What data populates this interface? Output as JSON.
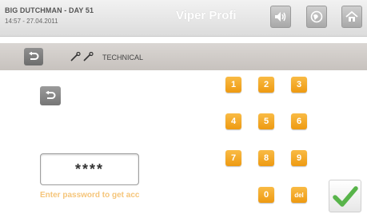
{
  "header": {
    "site": "BIG DUTCHMAN - DAY 51",
    "datetime": "14:57 - 27.04.2011",
    "app_name": "Viper Profi",
    "icons": [
      "speaker-icon",
      "globe-icon",
      "home-icon"
    ]
  },
  "subheader": {
    "breadcrumb": "TECHNICAL",
    "icons": [
      "back-icon",
      "wrench-icon"
    ]
  },
  "password": {
    "masked_value": "****",
    "hint": "Enter password to get acc"
  },
  "keypad": {
    "keys": [
      "1",
      "2",
      "3",
      "4",
      "5",
      "6",
      "7",
      "8",
      "9",
      "0",
      "del"
    ]
  },
  "colors": {
    "accent": "#F2A62A",
    "confirm": "#58B44A",
    "header": "#E6E6E6",
    "subheader": "#CFCAC6"
  }
}
